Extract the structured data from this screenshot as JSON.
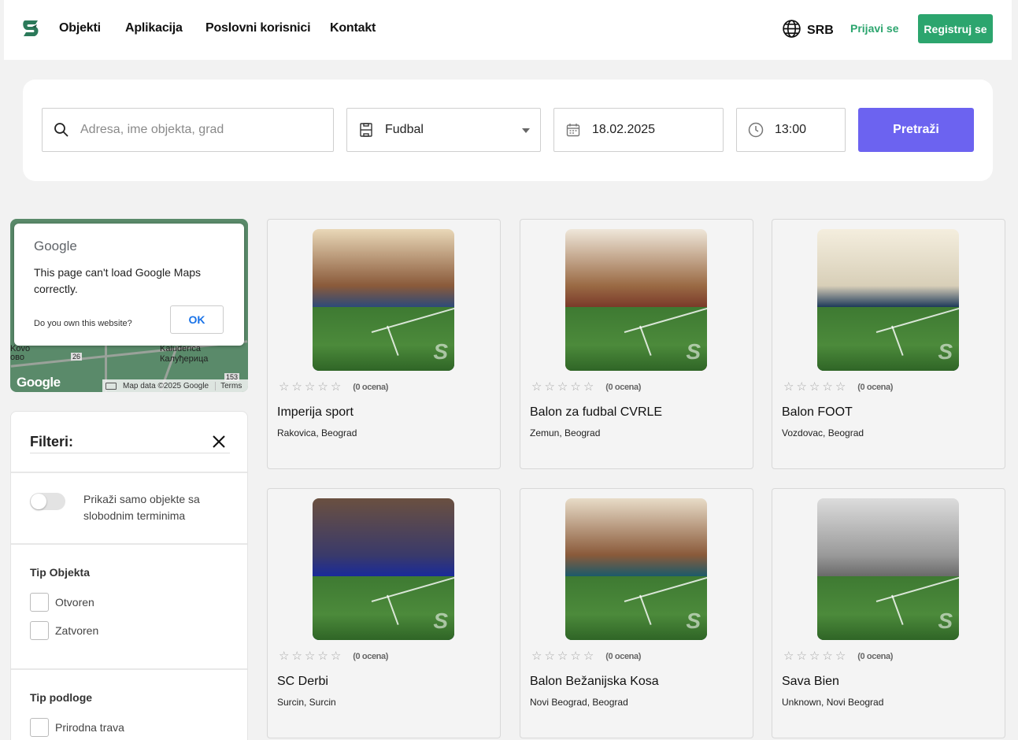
{
  "header": {
    "nav": [
      "Objekti",
      "Aplikacija",
      "Poslovni korisnici",
      "Kontakt"
    ],
    "language": "SRB",
    "login": "Prijavi se",
    "register": "Registruj se",
    "brand_color": "#2ca56e"
  },
  "search": {
    "placeholder": "Adresa, ime objekta, grad",
    "sport": "Fudbal",
    "date": "18.02.2025",
    "time": "13:00",
    "button": "Pretraži",
    "button_color": "#6c63f0"
  },
  "map": {
    "brand": "Google",
    "message": "This page can't load Google Maps correctly.",
    "own_question": "Do you own this website?",
    "ok": "OK",
    "labels": [
      "Kaluđerica",
      "Калуђерица",
      "Kovo",
      "ово",
      "26",
      "153"
    ],
    "map_data": "Map data ©2025 Google",
    "terms": "Terms",
    "logo_text": "Google"
  },
  "filters": {
    "title": "Filteri:",
    "free_slots_label": "Prikaži samo objekte sa slobodnim terminima",
    "type_title": "Tip Objekta",
    "types": [
      "Otvoren",
      "Zatvoren"
    ],
    "surface_title": "Tip podloge",
    "surfaces": [
      "Prirodna trava"
    ]
  },
  "venues": [
    {
      "name": "Imperija sport",
      "location": "Rakovica, Beograd",
      "reviews": "(0 ocena)"
    },
    {
      "name": "Balon za fudbal CVRLE",
      "location": "Zemun, Beograd",
      "reviews": "(0 ocena)"
    },
    {
      "name": "Balon FOOT",
      "location": "Vozdovac, Beograd",
      "reviews": "(0 ocena)"
    },
    {
      "name": "SC Derbi",
      "location": "Surcin, Surcin",
      "reviews": "(0 ocena)"
    },
    {
      "name": "Balon Bežanijska Kosa",
      "location": "Novi Beograd, Beograd",
      "reviews": "(0 ocena)"
    },
    {
      "name": "Sava Bien",
      "location": "Unknown, Novi Beograd",
      "reviews": "(0 ocena)"
    }
  ],
  "rating_stars": 0,
  "watermark": "S"
}
